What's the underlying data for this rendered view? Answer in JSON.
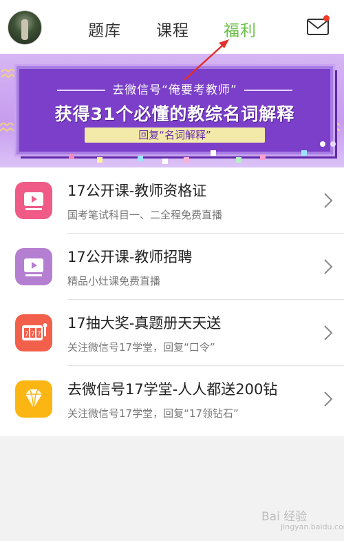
{
  "header": {
    "tabs": [
      {
        "label": "题库",
        "active": false
      },
      {
        "label": "课程",
        "active": false
      },
      {
        "label": "福利",
        "active": true
      }
    ],
    "mail_icon": "envelope-icon",
    "has_unread": true,
    "active_color": "#6cc04a"
  },
  "banner": {
    "line1": "去微信号“俺要考教师”",
    "line2": "获得31个必懂的教综名词解释",
    "line3": "回复“名词解释”",
    "bg_color": "#7b3fc9"
  },
  "items": [
    {
      "title": "17公开课-教师资格证",
      "subtitle": "国考笔试科目一、二全程免费直播",
      "icon": "video-play-icon",
      "color": "#ef5a86"
    },
    {
      "title": "17公开课-教师招聘",
      "subtitle": "精品小灶课免费直播",
      "icon": "video-play-icon",
      "color": "#b47fd1"
    },
    {
      "title": "17抽大奖-真题册天天送",
      "subtitle": "关注微信号17学堂，回复“口令”",
      "icon": "slot-machine-icon",
      "color": "#f2604c"
    },
    {
      "title": "去微信号17学堂-人人都送200钻",
      "subtitle": "关注微信号17学堂，回复“17领钻石”",
      "icon": "diamond-icon",
      "color": "#fcb614"
    }
  ],
  "watermark": {
    "text": "Bai 经验",
    "sub": "jingyan.baidu.com"
  }
}
